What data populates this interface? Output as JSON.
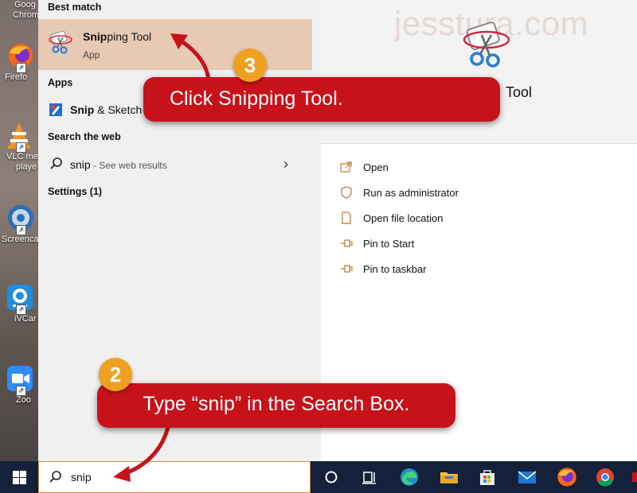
{
  "desktop": {
    "icons": [
      {
        "label_line1": "Goog",
        "label_line2": "Chrom"
      },
      {
        "label_line1": "Firefo",
        "label_line2": ""
      },
      {
        "label_line1": "VLC me",
        "label_line2": "playe"
      },
      {
        "label_line1": "Screenca",
        "label_line2": ""
      },
      {
        "label_line1": "iVCar",
        "label_line2": ""
      },
      {
        "label_line1": "Zoo",
        "label_line2": ""
      }
    ]
  },
  "start_menu": {
    "best_match_heading": "Best match",
    "best_match": {
      "name_bold": "Snip",
      "name_rest": "ping Tool",
      "type": "App",
      "icon": "snipping-tool-icon"
    },
    "apps_heading": "Apps",
    "apps": [
      {
        "name_bold": "Snip",
        "name_rest": " & Sketch",
        "icon": "snip-sketch-icon"
      }
    ],
    "web_heading": "Search the web",
    "web_result": {
      "query": "snip",
      "suffix": " - See web results",
      "icon": "search-icon"
    },
    "settings_heading": "Settings (1)"
  },
  "details": {
    "watermark": "jesstura.com",
    "app_title": "Tool",
    "actions": [
      {
        "label": "Open",
        "icon": "open-icon"
      },
      {
        "label": "Run as administrator",
        "icon": "shield-icon"
      },
      {
        "label": "Open file location",
        "icon": "file-location-icon"
      },
      {
        "label": "Pin to Start",
        "icon": "pin-icon"
      },
      {
        "label": "Pin to taskbar",
        "icon": "pin-icon"
      }
    ]
  },
  "taskbar": {
    "search_value": "snip",
    "apps": [
      "cortana-icon",
      "task-view-icon",
      "edge-icon",
      "file-explorer-icon",
      "store-icon",
      "mail-icon",
      "firefox-icon",
      "chrome-icon"
    ]
  },
  "callouts": {
    "step3": {
      "number": "3",
      "text": "Click Snipping Tool."
    },
    "step2": {
      "number": "2",
      "text": "Type “snip” in the Search Box."
    }
  },
  "colors": {
    "accent": "#c8121a",
    "badge": "#f0a020",
    "selection": "#e8c9b3",
    "taskbar": "#15203a"
  }
}
